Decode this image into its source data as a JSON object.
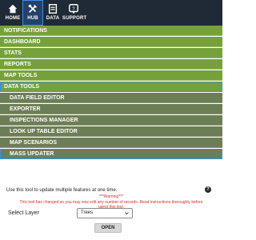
{
  "topnav": [
    {
      "label": "HOME",
      "icon": "home-icon"
    },
    {
      "label": "HUB",
      "icon": "tools-icon"
    },
    {
      "label": "DATA",
      "icon": "data-icon"
    },
    {
      "label": "SUPPORT",
      "icon": "support-icon"
    }
  ],
  "menu": {
    "top_items": [
      "NOTIFICATIONS",
      "DASHBOARD",
      "STATS",
      "REPORTS",
      "MAP TOOLS",
      "DATA TOOLS"
    ],
    "sub_items": [
      "DATA FIELD EDITOR",
      "EXPORTER",
      "INSPECTIONS MANAGER",
      "LOOK UP TABLE EDITOR",
      "MAP SCENARIOS",
      "MASS UPDATER"
    ]
  },
  "panel": {
    "description": "Use this tool to update multiple features at one time.",
    "help": "?",
    "warning_title": "***Warning***",
    "warning_line1": "This tool has changed so you may now edit any number of records. Read instructions thoroughly before",
    "warning_line2": "using this tool.",
    "select_layer_label": "Select Layer",
    "select_value": "Trees",
    "open_label": "OPEN"
  },
  "colors": {
    "topbar": "#1f2a36",
    "menu_green": "#76a13a",
    "submenu_olive": "#6c7e55",
    "selected_outline": "#3a8fe0",
    "warning_red": "#e02a2a"
  }
}
